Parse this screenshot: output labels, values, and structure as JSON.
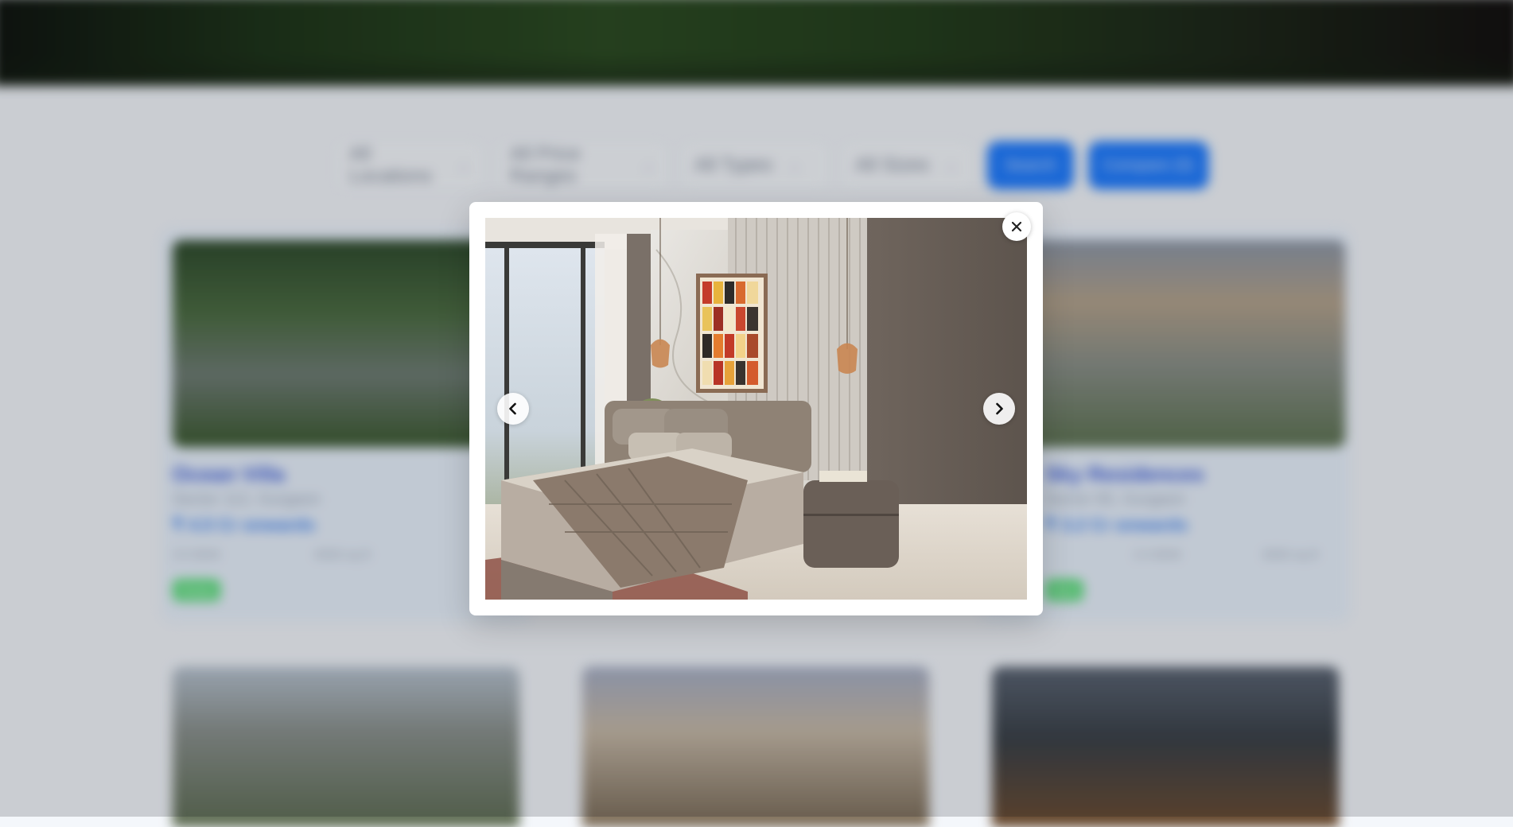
{
  "filters": [
    {
      "label": "All Locations"
    },
    {
      "label": "All Price Ranges"
    },
    {
      "label": "All Types"
    },
    {
      "label": "All Sizes"
    }
  ],
  "buttons": {
    "search": "Search",
    "compare": "Compare (0)"
  },
  "cards_row1": [
    {
      "title": "Ocean Villa",
      "subtitle": "Sector 112, Gurgaon",
      "price": "₹ 4.5 Cr onwards",
      "meta_left": "3-5 BHK",
      "meta_right": "4500 sq ft",
      "badge": "Ready"
    },
    {
      "title": "Sky Residences",
      "subtitle": "Sector 65, Gurgaon",
      "price": "₹ 3.2 Cr onwards",
      "meta_left": "2-4 BHK",
      "meta_right": "3000 sq ft",
      "badge": "New"
    }
  ],
  "modal": {
    "close_icon": "close-icon",
    "prev_icon": "chevron-left-icon",
    "next_icon": "chevron-right-icon"
  },
  "colors": {
    "accent": "#1e7bff",
    "badge": "#5fe07e",
    "scrim": "rgba(10,16,26,0.18)"
  }
}
